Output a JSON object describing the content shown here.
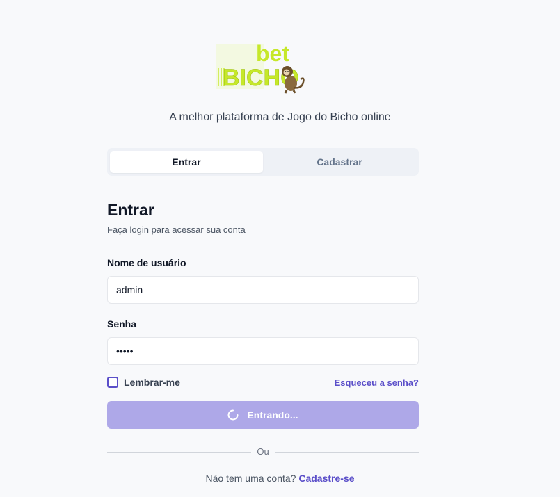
{
  "brand": {
    "logo_text_top": "bet",
    "logo_text_bottom": "BICHO",
    "tagline": "A melhor plataforma de Jogo do Bicho online"
  },
  "tabs": [
    {
      "label": "Entrar",
      "active": true
    },
    {
      "label": "Cadastrar",
      "active": false
    }
  ],
  "form": {
    "title": "Entrar",
    "subtitle": "Faça login para acessar sua conta",
    "username": {
      "label": "Nome de usuário",
      "value": "admin"
    },
    "password": {
      "label": "Senha",
      "value": "admin"
    },
    "remember_label": "Lembrar-me",
    "remember_checked": false,
    "forgot_label": "Esqueceu a senha?",
    "submit_label": "Entrando...",
    "divider_label": "Ou",
    "signup_prompt": "Não tem uma conta?",
    "signup_link": "Cadastre-se"
  },
  "colors": {
    "accent": "#5b4fc9",
    "button_loading": "#aea8e8",
    "logo_green": "#c6e82a",
    "background": "#f8f9fb"
  }
}
